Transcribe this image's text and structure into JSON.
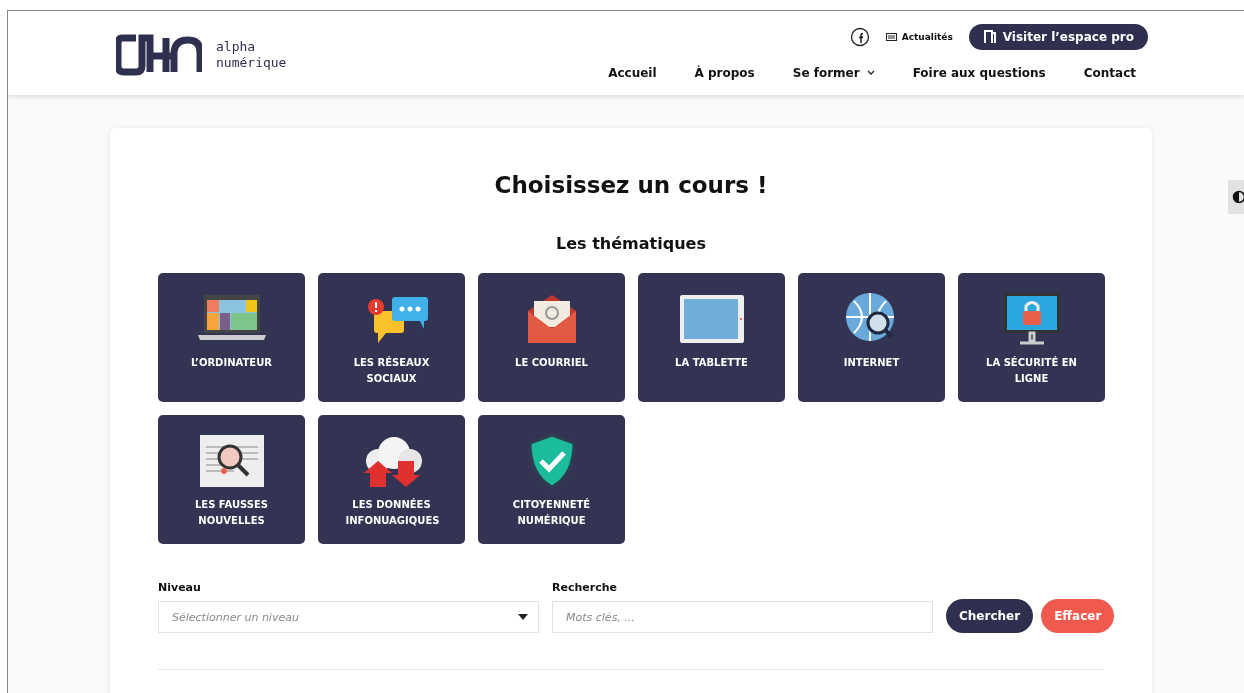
{
  "header": {
    "logo_text": "alpha numérique",
    "top_links": [
      {
        "kind": "facebook"
      },
      {
        "kind": "news",
        "label": "Actualités"
      }
    ],
    "pro_button": "Visiter l’espace pro",
    "nav": [
      {
        "label": "Accueil",
        "dropdown": false
      },
      {
        "label": "À propos",
        "dropdown": false
      },
      {
        "label": "Se former",
        "dropdown": true
      },
      {
        "label": "Foire aux questions",
        "dropdown": false
      },
      {
        "label": "Contact",
        "dropdown": false
      }
    ]
  },
  "main": {
    "title": "Choisissez un cours !",
    "subtitle": "Les thématiques",
    "themes": [
      {
        "kind": "laptop",
        "label": "L’ORDINATEUR"
      },
      {
        "kind": "chat",
        "label": "LES RÉSEAUX SOCIAUX"
      },
      {
        "kind": "mail",
        "label": "LE COURRIEL"
      },
      {
        "kind": "tablet",
        "label": "LA TABLETTE"
      },
      {
        "kind": "globe",
        "label": "INTERNET"
      },
      {
        "kind": "lock",
        "label": "LA SÉCURITÉ EN LIGNE"
      },
      {
        "kind": "news",
        "label": "LES FAUSSES NOUVELLES"
      },
      {
        "kind": "cloud",
        "label": "LES DONNÉES INFONUAGIQUES"
      },
      {
        "kind": "shield",
        "label": "CITOYENNETÉ NUMÉRIQUE"
      }
    ],
    "filters": {
      "level_label": "Niveau",
      "level_placeholder": "Sélectionner un niveau",
      "search_label": "Recherche",
      "search_placeholder": "Mots clés, ...",
      "search_button": "Chercher",
      "clear_button": "Effacer"
    }
  }
}
